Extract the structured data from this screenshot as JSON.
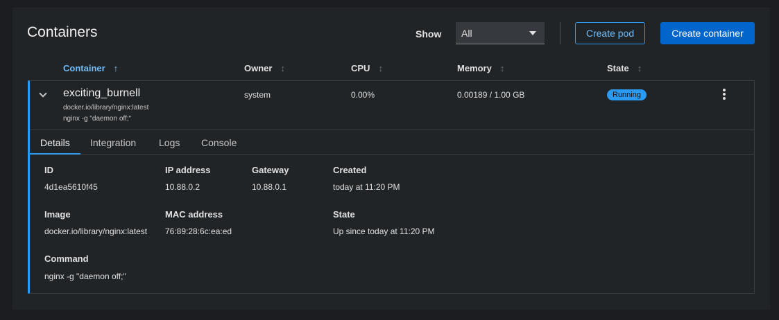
{
  "header": {
    "title": "Containers",
    "show_label": "Show",
    "show_value": "All",
    "create_pod": "Create pod",
    "create_container": "Create container"
  },
  "columns": {
    "container": "Container",
    "owner": "Owner",
    "cpu": "CPU",
    "memory": "Memory",
    "state": "State"
  },
  "row": {
    "name": "exciting_burnell",
    "image": "docker.io/library/nginx:latest",
    "command": "nginx -g \"daemon off;\"",
    "owner": "system",
    "cpu": "0.00%",
    "memory": "0.00189 / 1.00 GB",
    "state": "Running"
  },
  "tabs": [
    "Details",
    "Integration",
    "Logs",
    "Console"
  ],
  "details": {
    "id_label": "ID",
    "id_value": "4d1ea5610f45",
    "ip_label": "IP address",
    "ip_value": "10.88.0.2",
    "gateway_label": "Gateway",
    "gateway_value": "10.88.0.1",
    "created_label": "Created",
    "created_value": "today at 11:20 PM",
    "image_label": "Image",
    "image_value": "docker.io/library/nginx:latest",
    "mac_label": "MAC address",
    "mac_value": "76:89:28:6c:ea:ed",
    "state_label": "State",
    "state_value": "Up since today at 11:20 PM",
    "command_label": "Command",
    "command_value": "nginx -g \"daemon off;\""
  },
  "icons": {
    "sort_asc": "↑",
    "sort_both": "↕"
  },
  "colors": {
    "accent": "#2b9af3",
    "primary_button": "#0066cc",
    "background": "#1b1d21",
    "card": "#212427"
  }
}
